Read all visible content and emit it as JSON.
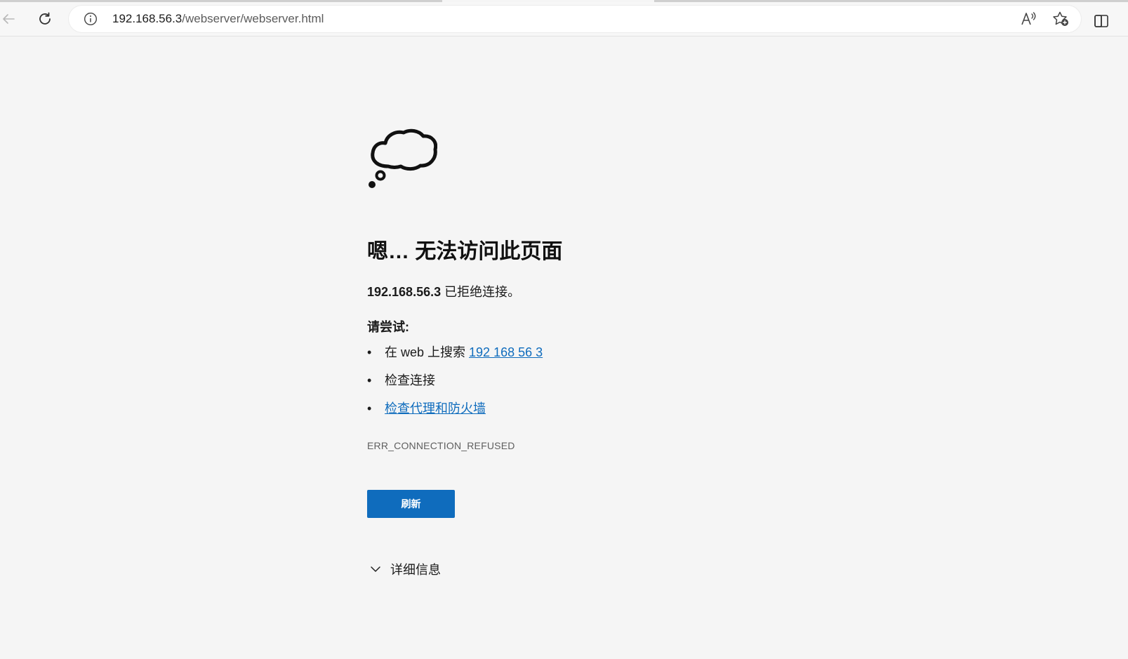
{
  "browser": {
    "url_host": "192.168.56.3",
    "url_path": "/webserver/webserver.html"
  },
  "icons": [
    "back-arrow-icon",
    "refresh-icon",
    "info-icon",
    "read-aloud-icon",
    "add-favorite-icon",
    "split-screen-icon",
    "thought-cloud-icon",
    "chevron-down-icon"
  ],
  "error": {
    "title": "嗯… 无法访问此页面",
    "host": "192.168.56.3",
    "message": " 已拒绝连接。",
    "try_label": "请尝试:",
    "tips": [
      {
        "prefix": "在 web 上搜索 ",
        "link": "192 168 56 3"
      },
      {
        "text": "检查连接"
      },
      {
        "link": "检查代理和防火墙"
      }
    ],
    "code": "ERR_CONNECTION_REFUSED",
    "refresh_button": "刷新",
    "details_label": "详细信息"
  },
  "colors": {
    "link": "#0f6cbd",
    "button": "#0f6cbd",
    "background": "#f5f5f5"
  }
}
